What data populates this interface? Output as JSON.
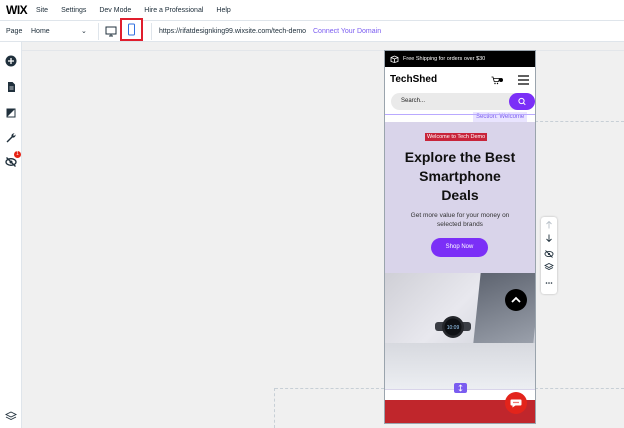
{
  "menu": {
    "logo": "WIX",
    "items": [
      "Site",
      "Settings",
      "Dev Mode",
      "Hire a Professional",
      "Help"
    ]
  },
  "toolbar": {
    "page_label": "Page",
    "page_value": "Home",
    "url": "https://rifatdesignking99.wixsite.com/tech-demo",
    "connect_domain": "Connect Your Domain",
    "desktop_icon": "desktop-icon",
    "mobile_icon": "mobile-icon"
  },
  "sidebar": {
    "icons": [
      "add-icon",
      "pages-icon",
      "design-icon",
      "tools-icon",
      "hidden-elements-icon"
    ],
    "badge": "1",
    "bottom_icon": "layers-icon"
  },
  "preview": {
    "promo": "Free Shipping for orders over $30",
    "brand": "TechShed",
    "search_placeholder": "Search...",
    "section_tag": "Section: Welcome",
    "welcome": "Welcome to Tech Demo",
    "headline_lines": [
      "Explore the Best",
      "Smartphone",
      "Deals"
    ],
    "subtext_lines": [
      "Get more value for your money on",
      "selected brands"
    ],
    "cta": "Shop Now"
  },
  "floating_tools": [
    "move-up-icon",
    "move-down-icon",
    "hide-icon",
    "layers-icon",
    "more-icon"
  ],
  "colors": {
    "accent": "#7b2ff7",
    "selection": "#e01e2d",
    "link": "#7a5cf0",
    "footer": "#c0262c"
  }
}
